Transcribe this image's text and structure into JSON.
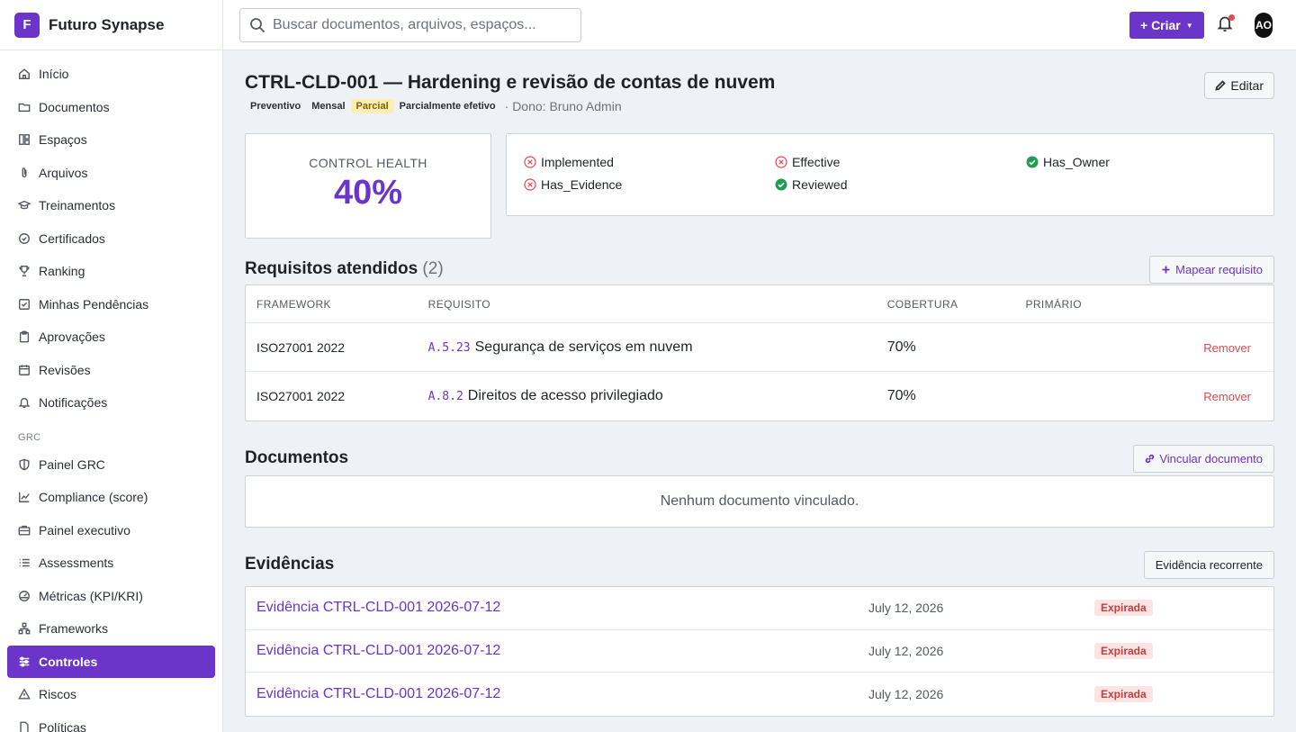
{
  "brand": {
    "logo_letter": "F",
    "name": "Futuro Synapse"
  },
  "sidebar": {
    "items": [
      {
        "label": "Início",
        "icon": "home-icon"
      },
      {
        "label": "Documentos",
        "icon": "folder-icon"
      },
      {
        "label": "Espaços",
        "icon": "layout-icon"
      },
      {
        "label": "Arquivos",
        "icon": "paperclip-icon"
      },
      {
        "label": "Treinamentos",
        "icon": "graduation-cap-icon"
      },
      {
        "label": "Certificados",
        "icon": "badge-check-icon"
      },
      {
        "label": "Ranking",
        "icon": "trophy-icon"
      },
      {
        "label": "Minhas Pendências",
        "icon": "checkbox-icon"
      },
      {
        "label": "Aprovações",
        "icon": "clipboard-icon"
      },
      {
        "label": "Revisões",
        "icon": "calendar-icon"
      },
      {
        "label": "Notificações",
        "icon": "bell-icon"
      }
    ],
    "section_label": "GRC",
    "grc_items": [
      {
        "label": "Painel GRC",
        "icon": "shield-icon"
      },
      {
        "label": "Compliance (score)",
        "icon": "trend-icon"
      },
      {
        "label": "Painel executivo",
        "icon": "briefcase-icon"
      },
      {
        "label": "Assessments",
        "icon": "list-icon"
      },
      {
        "label": "Métricas (KPI/KRI)",
        "icon": "gauge-icon"
      },
      {
        "label": "Frameworks",
        "icon": "network-icon"
      },
      {
        "label": "Controles",
        "icon": "sliders-icon",
        "active": true
      },
      {
        "label": "Riscos",
        "icon": "warning-icon"
      },
      {
        "label": "Políticas",
        "icon": "file-icon"
      }
    ]
  },
  "topbar": {
    "search_placeholder": "Buscar documentos, arquivos, espaços...",
    "create_label": "+ Criar",
    "avatar_initials": "AO"
  },
  "control": {
    "title": "CTRL-CLD-001 — Hardening e revisão de contas de nuvem",
    "badges": [
      "Preventivo",
      "Mensal",
      "Parcial",
      "Parcialmente efetivo"
    ],
    "owner": "· Dono: Bruno Admin",
    "edit_label": "Editar"
  },
  "health": {
    "label": "CONTROL HEALTH",
    "value": "40%",
    "value_fraction": 0.4
  },
  "checks": [
    {
      "label": "Implemented",
      "ok": false
    },
    {
      "label": "Effective",
      "ok": false
    },
    {
      "label": "Has_Owner",
      "ok": true
    },
    {
      "label": "Has_Evidence",
      "ok": false
    },
    {
      "label": "Reviewed",
      "ok": true
    }
  ],
  "requirements": {
    "title": "Requisitos atendidos",
    "count": "(2)",
    "map_label": "Mapear requisito",
    "columns": [
      "FRAMEWORK",
      "REQUISITO",
      "COBERTURA",
      "PRIMÁRIO"
    ],
    "rows": [
      {
        "framework": "ISO27001 2022",
        "code": "A.5.23",
        "name": "Segurança de serviços em nuvem",
        "coverage": "70%",
        "action": "Remover"
      },
      {
        "framework": "ISO27001 2022",
        "code": "A.8.2",
        "name": "Direitos de acesso privilegiado",
        "coverage": "70%",
        "action": "Remover"
      }
    ]
  },
  "documents": {
    "title": "Documentos",
    "link_label": "Vincular documento",
    "empty": "Nenhum documento vinculado."
  },
  "evidences": {
    "title": "Evidências",
    "recurring_label": "Evidência recorrente",
    "rows": [
      {
        "title": "Evidência CTRL-CLD-001 2026-07-12",
        "date": "July 12, 2026",
        "status": "Expirada"
      },
      {
        "title": "Evidência CTRL-CLD-001 2026-07-12",
        "date": "July 12, 2026",
        "status": "Expirada"
      },
      {
        "title": "Evidência CTRL-CLD-001 2026-07-12",
        "date": "July 12, 2026",
        "status": "Expirada"
      }
    ]
  }
}
